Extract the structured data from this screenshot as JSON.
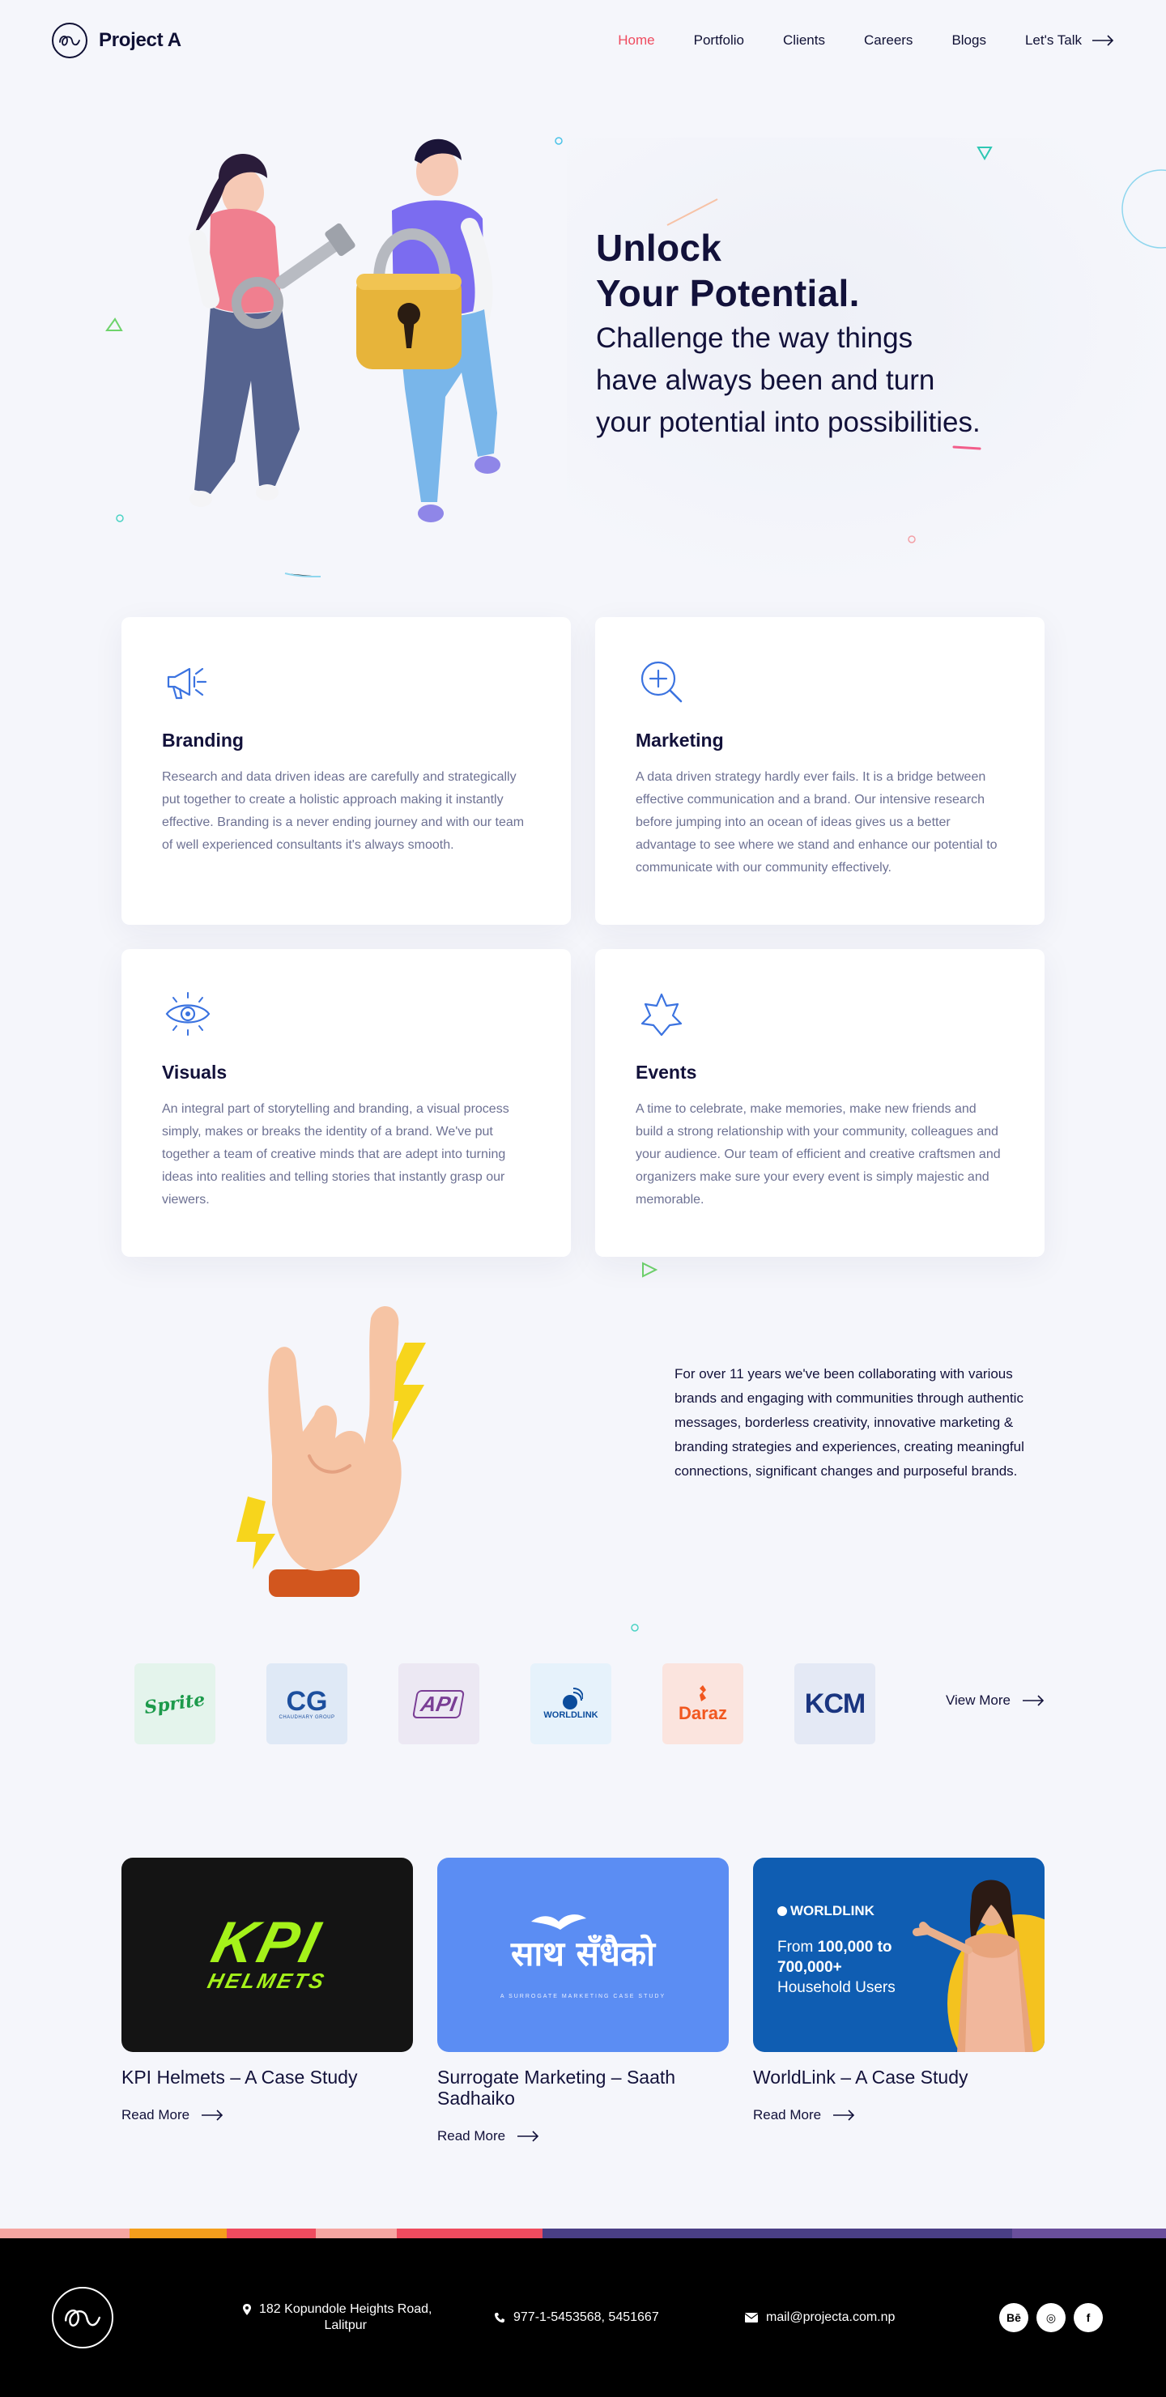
{
  "header": {
    "brand": "Project A",
    "nav": [
      "Home",
      "Portfolio",
      "Clients",
      "Careers",
      "Blogs"
    ],
    "cta": "Let's Talk"
  },
  "hero": {
    "title_line1": "Unlock",
    "title_line2": "Your Potential.",
    "sub_line1": "Challenge the way things",
    "sub_line2": "have always been and turn",
    "sub_line3": "your potential into possibilities."
  },
  "services": [
    {
      "icon": "megaphone-icon",
      "title": "Branding",
      "text": "Research and data driven ideas are carefully and strategically put together to create a holistic approach making it instantly effective. Branding is a never ending journey and with our team of well experienced consultants it's always smooth."
    },
    {
      "icon": "magnify-plus-icon",
      "title": "Marketing",
      "text": "A data driven strategy hardly ever fails. It is a bridge between effective communication and a brand. Our intensive research before jumping into an ocean of ideas gives us a better advantage to see where we stand and enhance our potential to communicate with our community effectively."
    },
    {
      "icon": "eye-icon",
      "title": "Visuals",
      "text": "An integral part of storytelling and branding, a visual process simply, makes or breaks the identity of a brand. We've put together a team of creative minds that are adept into turning ideas into realities and telling stories that instantly grasp our viewers."
    },
    {
      "icon": "star-icon",
      "title": "Events",
      "text": "A time to celebrate, make memories, make new friends and build a strong relationship with your community, colleagues and your audience. Our team of efficient and creative craftsmen and organizers make sure your every event is simply majestic and memorable."
    }
  ],
  "about": {
    "text": "For over 11 years we've been collaborating with various brands and engaging with communities through authentic messages, borderless creativity, innovative marketing & branding strategies and experiences, creating meaningful connections, significant changes and purposeful brands."
  },
  "clients": {
    "logos": [
      {
        "name": "Sprite",
        "bg": "#e4f4ec",
        "color": "#1c9a4b"
      },
      {
        "name": "CG",
        "sub": "CHAUDHARY GROUP",
        "bg": "#dfe9f6",
        "color": "#1d4f9e"
      },
      {
        "name": "API",
        "bg": "#ece8f3",
        "color": "#7a3e95"
      },
      {
        "name": "WORLDLINK",
        "bg": "#e6f2fb",
        "color": "#0b4c9c"
      },
      {
        "name": "Daraz",
        "bg": "#fbe4de",
        "color": "#f1571f"
      },
      {
        "name": "KCM",
        "bg": "#e4e9f5",
        "color": "#1a3580"
      }
    ],
    "view_more": "View More"
  },
  "cases": [
    {
      "title": "KPI Helmets – A Case Study",
      "link": "Read More",
      "thumb_text": "KPI",
      "thumb_sub": "HELMETS"
    },
    {
      "title": "Surrogate Marketing – Saath Sadhaiko",
      "link": "Read More",
      "thumb_text": "साथ सँधैको",
      "thumb_sub": "A SURROGATE MARKETING CASE STUDY"
    },
    {
      "title": "WorldLink – A Case Study",
      "link": "Read More",
      "thumb_brand": "WORLDLINK",
      "thumb_l1": "From",
      "thumb_l1b": "100,000 to",
      "thumb_l2": "700,000+",
      "thumb_l3": "Household Users"
    }
  ],
  "footer": {
    "address_line1": "182 Kopundole Heights Road,",
    "address_line2": "Lalitpur",
    "phone": "977-1-5453568, 5451667",
    "email": "mail@projecta.com.np",
    "social": [
      "Bē",
      "◎",
      "f"
    ]
  },
  "colors": {
    "accent": "#ef4b5f",
    "dark": "#12113a",
    "icon_blue": "#3b73e0"
  }
}
